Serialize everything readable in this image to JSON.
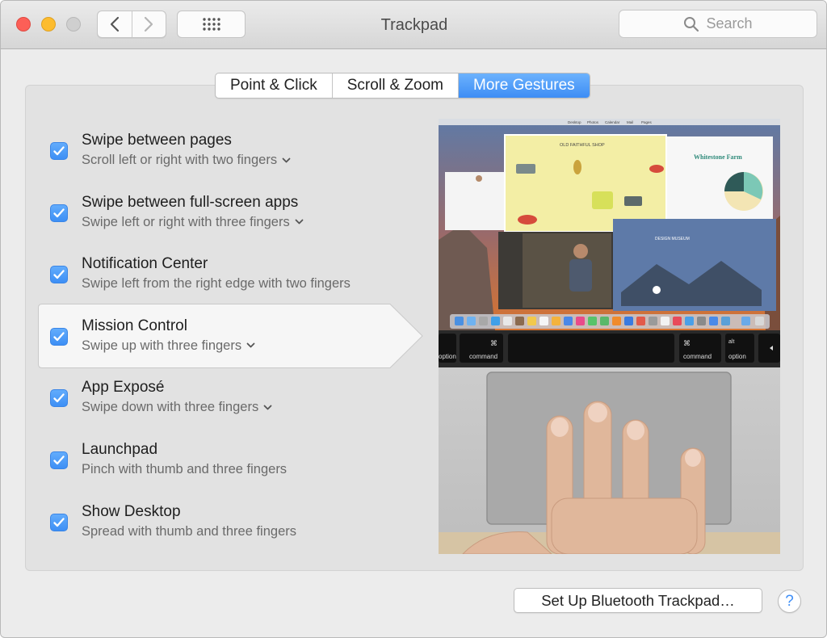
{
  "window": {
    "title": "Trackpad",
    "search_placeholder": "Search"
  },
  "tabs": [
    {
      "label": "Point & Click",
      "active": false
    },
    {
      "label": "Scroll & Zoom",
      "active": false
    },
    {
      "label": "More Gestures",
      "active": true
    }
  ],
  "gestures": [
    {
      "title": "Swipe between pages",
      "subtitle": "Scroll left or right with two fingers",
      "has_menu": true,
      "checked": true
    },
    {
      "title": "Swipe between full-screen apps",
      "subtitle": "Swipe left or right with three fingers",
      "has_menu": true,
      "checked": true
    },
    {
      "title": "Notification Center",
      "subtitle": "Swipe left from the right edge with two fingers",
      "has_menu": false,
      "checked": true
    },
    {
      "title": "Mission Control",
      "subtitle": "Swipe up with three fingers",
      "has_menu": true,
      "checked": true,
      "selected": true
    },
    {
      "title": "App Exposé",
      "subtitle": "Swipe down with three fingers",
      "has_menu": true,
      "checked": true
    },
    {
      "title": "Launchpad",
      "subtitle": "Pinch with thumb and three fingers",
      "has_menu": false,
      "checked": true
    },
    {
      "title": "Show Desktop",
      "subtitle": "Spread with thumb and three fingers",
      "has_menu": false,
      "checked": true
    }
  ],
  "preview": {
    "menu_items": [
      "Desktop",
      "Photos",
      "Calendar",
      "Mail",
      "Pages"
    ],
    "shop_title": "OLD FAITHFUL SHOP",
    "farm_title": "Whitestone Farm",
    "museum_title": "DESIGN MUSEUM",
    "keys": {
      "alt": "alt",
      "option": "option",
      "command": "command",
      "command_symbol": "⌘"
    }
  },
  "footer": {
    "setup_label": "Set Up Bluetooth Trackpad…",
    "help_label": "?"
  },
  "colors": {
    "accent": "#3d8df5",
    "checkbox": "#4a97f7",
    "close": "#fc5f57",
    "minimize": "#fdbc2e"
  }
}
